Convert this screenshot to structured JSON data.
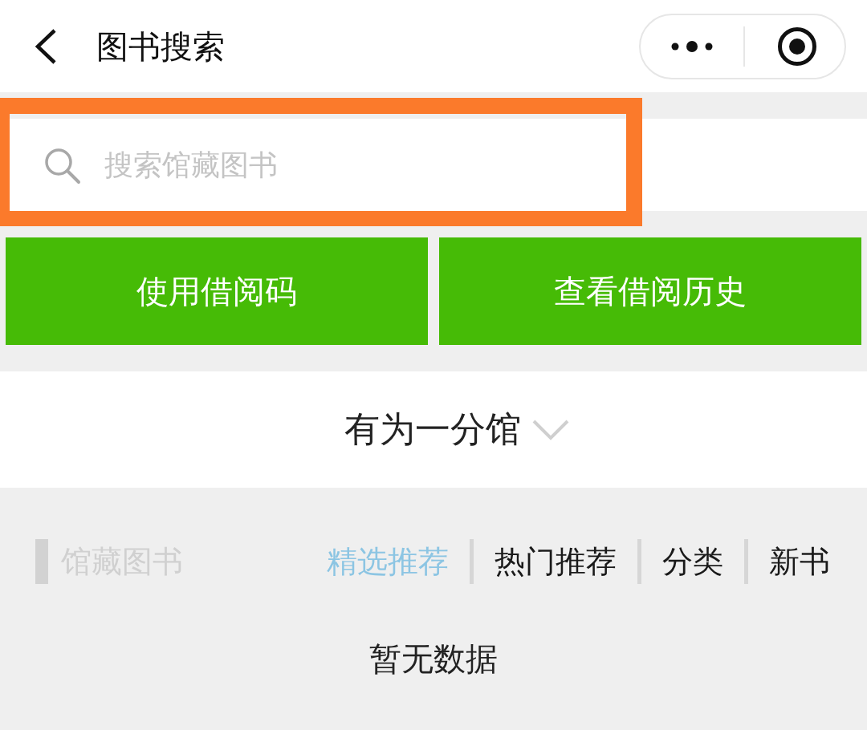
{
  "nav": {
    "title": "图书搜索"
  },
  "search": {
    "placeholder": "搜索馆藏图书",
    "highlighted": true
  },
  "actions": [
    {
      "label": "使用借阅码"
    },
    {
      "label": "查看借阅历史"
    }
  ],
  "branch": {
    "name": "有为一分馆"
  },
  "collection": {
    "title": "馆藏图书",
    "tabs": [
      {
        "label": "精选推荐",
        "selected": true
      },
      {
        "label": "热门推荐",
        "selected": false
      },
      {
        "label": "分类",
        "selected": false
      },
      {
        "label": "新书",
        "selected": false
      }
    ]
  },
  "empty_state": {
    "text": "暂无数据"
  }
}
